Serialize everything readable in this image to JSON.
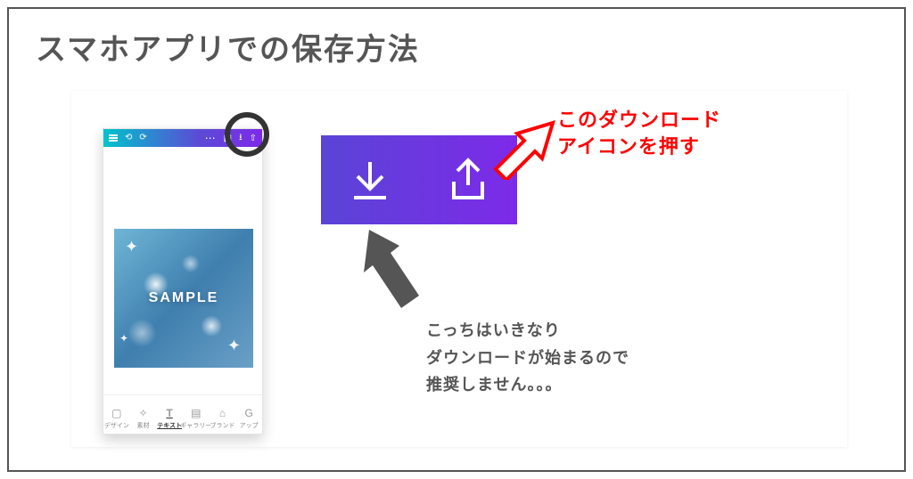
{
  "title": "スマホアプリでの保存方法",
  "phone": {
    "sample_label": "SAMPLE",
    "bottom_tabs": [
      "デザイン",
      "素材",
      "テキスト",
      "ギャラリー",
      "ブランド",
      "アップ"
    ]
  },
  "annotations": {
    "red_line1": "このダウンロード",
    "red_line2": "アイコンを押す",
    "grey_line1": "こっちはいきなり",
    "grey_line2": "ダウンロードが始まるので",
    "grey_line3": "推奨しません。。。"
  }
}
